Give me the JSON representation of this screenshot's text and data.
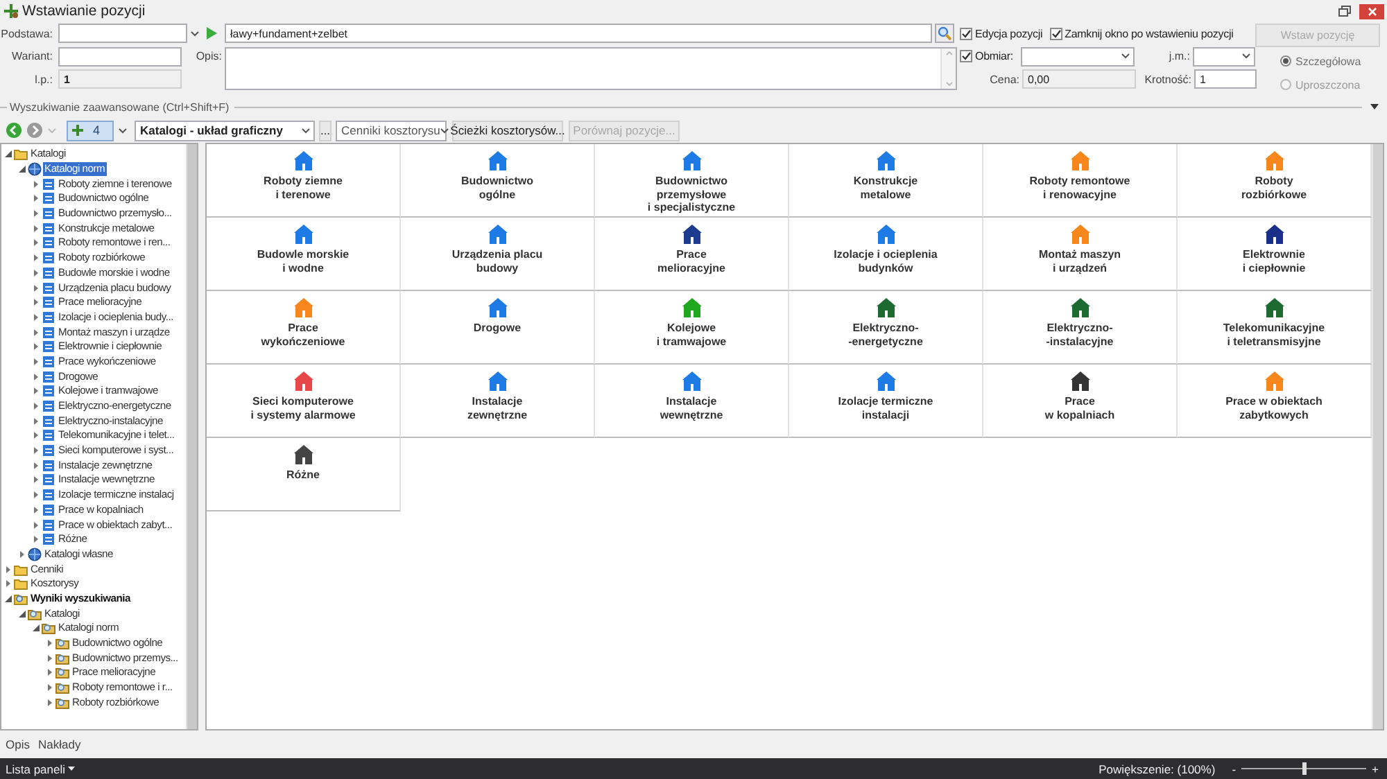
{
  "window": {
    "title": "Wstawianie pozycji"
  },
  "form": {
    "podstawa": {
      "label": "Podstawa:"
    },
    "query": "ławy+fundament+zelbet",
    "edycja": {
      "label": "Edycja pozycji",
      "checked": true
    },
    "zamknij": {
      "label": "Zamknij okno po wstawieniu pozycji",
      "checked": true
    },
    "insert_button": {
      "label": "Wstaw pozycję",
      "disabled": true
    },
    "wariant": {
      "label": "Wariant:"
    },
    "opis": {
      "label": "Opis:"
    },
    "lp": {
      "label": "l.p.:",
      "value": "1"
    },
    "obmiar": {
      "label": "Obmiar:",
      "checked": true
    },
    "jm": {
      "label": "j.m.:"
    },
    "cena": {
      "label": "Cena:",
      "value": "0,00"
    },
    "krotnosc": {
      "label": "Krotność:",
      "value": "1"
    },
    "mode_radios": [
      {
        "label": "Szczegółowa",
        "selected": true,
        "disabled": true
      },
      {
        "label": "Uproszczona",
        "selected": false,
        "disabled": true
      }
    ]
  },
  "advanced_search": {
    "label": "Wyszukiwanie zaawansowane (Ctrl+Shift+F)"
  },
  "toolbar": {
    "history": "4",
    "view": "Katalogi - układ graficzny",
    "more": "...",
    "price_list": "Cenniki kosztorysu",
    "buttons": [
      {
        "label": "Ścieżki kosztorysów...",
        "disabled": false
      },
      {
        "label": "Porównaj pozycje...",
        "disabled": true
      }
    ]
  },
  "tree": [
    {
      "label": "Katalogi",
      "kind": "folder",
      "expanded": true,
      "selected": false,
      "children": [
        {
          "label": "Katalogi norm",
          "kind": "catalog",
          "expanded": true,
          "selected": true,
          "children": [
            {
              "label": "Roboty ziemne i terenowe",
              "kind": "category",
              "expanded": false,
              "selected": false
            },
            {
              "label": "Budownictwo ogólne",
              "kind": "category",
              "expanded": false,
              "selected": false
            },
            {
              "label": "Budownictwo przemysło...",
              "kind": "category",
              "expanded": false,
              "selected": false
            },
            {
              "label": "Konstrukcje metalowe",
              "kind": "category",
              "expanded": false,
              "selected": false
            },
            {
              "label": "Roboty remontowe i ren...",
              "kind": "category",
              "expanded": false,
              "selected": false
            },
            {
              "label": "Roboty rozbiórkowe",
              "kind": "category",
              "expanded": false,
              "selected": false
            },
            {
              "label": "Budowle morskie i wodne",
              "kind": "category",
              "expanded": false,
              "selected": false
            },
            {
              "label": "Urządzenia placu budowy",
              "kind": "category",
              "expanded": false,
              "selected": false
            },
            {
              "label": "Prace melioracyjne",
              "kind": "category",
              "expanded": false,
              "selected": false
            },
            {
              "label": "Izolacje i ocieplenia budy...",
              "kind": "category",
              "expanded": false,
              "selected": false
            },
            {
              "label": "Montaż maszyn i urządze",
              "kind": "category",
              "expanded": false,
              "selected": false
            },
            {
              "label": "Elektrownie i ciepłownie",
              "kind": "category",
              "expanded": false,
              "selected": false
            },
            {
              "label": "Prace wykończeniowe",
              "kind": "category",
              "expanded": false,
              "selected": false
            },
            {
              "label": "Drogowe",
              "kind": "category",
              "expanded": false,
              "selected": false
            },
            {
              "label": "Kolejowe i tramwajowe",
              "kind": "category",
              "expanded": false,
              "selected": false
            },
            {
              "label": "Elektryczno-energetyczne",
              "kind": "category",
              "expanded": false,
              "selected": false
            },
            {
              "label": "Elektryczno-instalacyjne",
              "kind": "category",
              "expanded": false,
              "selected": false
            },
            {
              "label": "Telekomunikacyjne i telet...",
              "kind": "category",
              "expanded": false,
              "selected": false
            },
            {
              "label": "Sieci komputerowe i syst...",
              "kind": "category",
              "expanded": false,
              "selected": false
            },
            {
              "label": "Instalacje zewnętrzne",
              "kind": "category",
              "expanded": false,
              "selected": false
            },
            {
              "label": "Instalacje wewnętrzne",
              "kind": "category",
              "expanded": false,
              "selected": false
            },
            {
              "label": "Izolacje termiczne instalacj",
              "kind": "category",
              "expanded": false,
              "selected": false
            },
            {
              "label": "Prace w kopalniach",
              "kind": "category",
              "expanded": false,
              "selected": false
            },
            {
              "label": "Prace w obiektach zabyt...",
              "kind": "category",
              "expanded": false,
              "selected": false
            },
            {
              "label": "Różne",
              "kind": "category",
              "expanded": false,
              "selected": false
            }
          ]
        },
        {
          "label": "Katalogi własne",
          "kind": "catalog",
          "expanded": false,
          "selected": false
        }
      ]
    },
    {
      "label": "Cenniki",
      "kind": "folder",
      "expanded": false,
      "selected": false
    },
    {
      "label": "Kosztorysy",
      "kind": "folder",
      "expanded": false,
      "selected": false
    },
    {
      "label": "Wyniki wyszukiwania",
      "kind": "results",
      "expanded": true,
      "selected": false,
      "children": [
        {
          "label": "Katalogi",
          "kind": "result",
          "expanded": true,
          "selected": false,
          "children": [
            {
              "label": "Katalogi norm",
              "kind": "result",
              "expanded": true,
              "selected": false,
              "children": [
                {
                  "label": "Budownictwo ogólne",
                  "kind": "result",
                  "expanded": false,
                  "selected": false
                },
                {
                  "label": "Budownictwo przemys...",
                  "kind": "result",
                  "expanded": false,
                  "selected": false
                },
                {
                  "label": "Prace melioracyjne",
                  "kind": "result",
                  "expanded": false,
                  "selected": false
                },
                {
                  "label": "Roboty remontowe i r...",
                  "kind": "result",
                  "expanded": false,
                  "selected": false
                },
                {
                  "label": "Roboty rozbiórkowe",
                  "kind": "result",
                  "expanded": false,
                  "selected": false
                }
              ]
            }
          ]
        }
      ]
    }
  ],
  "tiles": [
    {
      "label": "Roboty ziemne\ni terenowe",
      "color": "#1e7be6"
    },
    {
      "label": "Budownictwo\nogólne",
      "color": "#1e7be6"
    },
    {
      "label": "Budownictwo\nprzemysłowe\ni specjalistyczne",
      "color": "#1e7be6"
    },
    {
      "label": "Konstrukcje\nmetalowe",
      "color": "#1e7be6"
    },
    {
      "label": "Roboty remontowe\ni renowacyjne",
      "color": "#f7861c"
    },
    {
      "label": "Roboty\nrozbiórkowe",
      "color": "#f7861c"
    },
    {
      "label": "Budowle morskie\ni wodne",
      "color": "#1e7be6"
    },
    {
      "label": "Urządzenia placu\nbudowy",
      "color": "#1e7be6"
    },
    {
      "label": "Prace\nmelioracyjne",
      "color": "#1d3b8f"
    },
    {
      "label": "Izolacje i ocieplenia\nbudynków",
      "color": "#1e7be6"
    },
    {
      "label": "Montaż maszyn\ni urządzeń",
      "color": "#f7861c"
    },
    {
      "label": "Elektrownie\ni ciepłownie",
      "color": "#1a2f8a"
    },
    {
      "label": "Prace\nwykończeniowe",
      "color": "#f7861c"
    },
    {
      "label": "Drogowe",
      "color": "#1e7be6"
    },
    {
      "label": "Kolejowe\ni tramwajowe",
      "color": "#1fa81f"
    },
    {
      "label": "Elektryczno-\n-energetyczne",
      "color": "#1e6b32"
    },
    {
      "label": "Elektryczno-\n-instalacyjne",
      "color": "#1e6b32"
    },
    {
      "label": "Telekomunikacyjne\ni teletransmisyjne",
      "color": "#1e6b32"
    },
    {
      "label": "Sieci komputerowe\ni systemy alarmowe",
      "color": "#e8474a"
    },
    {
      "label": "Instalacje\nzewnętrzne",
      "color": "#1e7be6"
    },
    {
      "label": "Instalacje\nwewnętrzne",
      "color": "#1e7be6"
    },
    {
      "label": "Izolacje termiczne\ninstalacji",
      "color": "#1e7be6"
    },
    {
      "label": "Prace\nw kopalniach",
      "color": "#333333"
    },
    {
      "label": "Prace w obiektach\nzabytkowych",
      "color": "#f7861c"
    },
    {
      "label": "Różne",
      "color": "#444444"
    }
  ],
  "bottom_tabs": [
    "Opis",
    "Nakłady"
  ],
  "status_bar": {
    "panels": "Lista paneli",
    "zoom_label": "Powiększenie: (100%)",
    "zoom_out": "-",
    "zoom_in": "+",
    "zoom": {
      "level": 0.5
    }
  }
}
